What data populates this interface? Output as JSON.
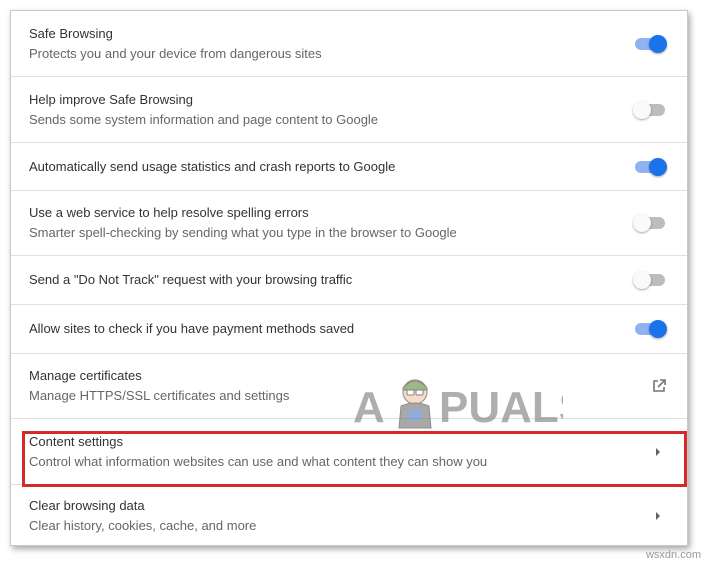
{
  "settings": [
    {
      "title": "Safe Browsing",
      "subtitle": "Protects you and your device from dangerous sites",
      "control": "toggle",
      "enabled": true
    },
    {
      "title": "Help improve Safe Browsing",
      "subtitle": "Sends some system information and page content to Google",
      "control": "toggle",
      "enabled": false
    },
    {
      "title": "Automatically send usage statistics and crash reports to Google",
      "subtitle": "",
      "control": "toggle",
      "enabled": true
    },
    {
      "title": "Use a web service to help resolve spelling errors",
      "subtitle": "Smarter spell-checking by sending what you type in the browser to Google",
      "control": "toggle",
      "enabled": false
    },
    {
      "title": "Send a \"Do Not Track\" request with your browsing traffic",
      "subtitle": "",
      "control": "toggle",
      "enabled": false
    },
    {
      "title": "Allow sites to check if you have payment methods saved",
      "subtitle": "",
      "control": "toggle",
      "enabled": true
    },
    {
      "title": "Manage certificates",
      "subtitle": "Manage HTTPS/SSL certificates and settings",
      "control": "external-link-icon"
    },
    {
      "title": "Content settings",
      "subtitle": "Control what information websites can use and what content they can show you",
      "control": "arrow-right-icon",
      "highlighted": true
    },
    {
      "title": "Clear browsing data",
      "subtitle": "Clear history, cookies, cache, and more",
      "control": "arrow-right-icon"
    }
  ],
  "logo_text": "APPUALS",
  "watermark": "wsxdn.com",
  "colors": {
    "toggle_on": "#1a73e8",
    "toggle_on_track": "#8fb3f0",
    "toggle_off_knob": "#fafafa",
    "toggle_off_track": "#bdbdbd",
    "highlight_border": "#d42a2a"
  }
}
